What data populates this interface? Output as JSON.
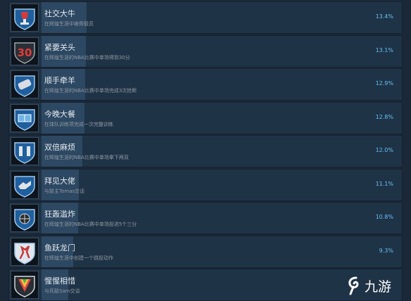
{
  "achievements": [
    {
      "title": "社交大牛",
      "desc": "在辉煌生涯中被骨毅员",
      "percent": "13.4%",
      "progress": 13.4,
      "icon": "trophy-badge-icon"
    },
    {
      "title": "紧要关头",
      "desc": "在辉煌生涯的NBA比赛中单场得到30分",
      "percent": "13.1%",
      "progress": 13.1,
      "icon": "thirty-points-badge-icon"
    },
    {
      "title": "顺手牵羊",
      "desc": "在辉煌生涯的NBA比赛中单场完成3次抢断",
      "percent": "12.9%",
      "progress": 12.9,
      "icon": "steal-hand-badge-icon"
    },
    {
      "title": "今晚大餐",
      "desc": "在球队训练项完成一次完整训练",
      "percent": "12.8%",
      "progress": 12.8,
      "icon": "court-badge-icon"
    },
    {
      "title": "双倍麻烦",
      "desc": "在辉煌生涯的NBA比赛中单场拿下两双",
      "percent": "12.0%",
      "progress": 12.0,
      "icon": "double-trophy-badge-icon"
    },
    {
      "title": "拜见大佬",
      "desc": "与骰主Tomas交谈",
      "percent": "11.1%",
      "progress": 11.1,
      "icon": "handshake-badge-icon"
    },
    {
      "title": "狂轰滥炸",
      "desc": "在辉煌生涯的NBA比赛中单场投进5个三分",
      "percent": "10.8%",
      "progress": 10.8,
      "icon": "basketball-badge-icon"
    },
    {
      "title": "鱼跃龙门",
      "desc": "在辉煌生涯中创建一个跳投动作",
      "percent": "9.3%",
      "progress": 9.3,
      "icon": "jumpshot-badge-icon"
    },
    {
      "title": "惺惺相惜",
      "desc": "与死敌Sam交谈",
      "percent": "",
      "progress": 8.0,
      "icon": "rainbow-badge-icon"
    }
  ],
  "watermark": {
    "text": "九游",
    "icon": "swirl-logo-icon"
  },
  "colors": {
    "background": "#1b2838",
    "row": "#1f3347",
    "progress": "#2d4862",
    "percent_text": "#66c0f4",
    "title_text": "#e4e9ee",
    "desc_text": "#8f98a0",
    "badge_blue": "#1f5f9e"
  }
}
